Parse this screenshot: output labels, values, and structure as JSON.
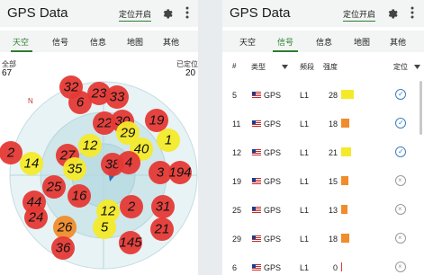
{
  "left_panel": {
    "app_title": "GPS Data",
    "locate_label": "定位开启",
    "tabs": [
      "天空",
      "信号",
      "信息",
      "地图",
      "其他"
    ],
    "active_tab": 0,
    "total_label": "全部",
    "total_value": "67",
    "fixed_label": "已定位",
    "fixed_value": "20",
    "compass_north": "N",
    "satellites": [
      {
        "id": "32",
        "color": "#e53935"
      },
      {
        "id": "6",
        "color": "#e53935"
      },
      {
        "id": "23",
        "color": "#e53935"
      },
      {
        "id": "33",
        "color": "#e53935"
      },
      {
        "id": "22",
        "color": "#e53935"
      },
      {
        "id": "30",
        "color": "#e53935"
      },
      {
        "id": "19",
        "color": "#e53935"
      },
      {
        "id": "29",
        "color": "#f4ea2a"
      },
      {
        "id": "1",
        "color": "#f4ea2a"
      },
      {
        "id": "2",
        "color": "#e53935"
      },
      {
        "id": "12",
        "color": "#f4ea2a"
      },
      {
        "id": "40",
        "color": "#f4ea2a"
      },
      {
        "id": "14",
        "color": "#f4ea2a"
      },
      {
        "id": "27",
        "color": "#e53935"
      },
      {
        "id": "35",
        "color": "#f4ea2a"
      },
      {
        "id": "38",
        "color": "#e53935"
      },
      {
        "id": "4",
        "color": "#e53935"
      },
      {
        "id": "3",
        "color": "#e53935"
      },
      {
        "id": "194",
        "color": "#e53935"
      },
      {
        "id": "25",
        "color": "#e53935"
      },
      {
        "id": "16",
        "color": "#e53935"
      },
      {
        "id": "44",
        "color": "#e53935"
      },
      {
        "id": "24",
        "color": "#e53935"
      },
      {
        "id": "12",
        "color": "#f4ea2a"
      },
      {
        "id": "2",
        "color": "#e53935"
      },
      {
        "id": "31",
        "color": "#e53935"
      },
      {
        "id": "26",
        "color": "#f08c2b"
      },
      {
        "id": "5",
        "color": "#f4ea2a"
      },
      {
        "id": "21",
        "color": "#e53935"
      },
      {
        "id": "36",
        "color": "#e53935"
      },
      {
        "id": "145",
        "color": "#e53935"
      }
    ]
  },
  "right_panel": {
    "app_title": "GPS Data",
    "locate_label": "定位开启",
    "tabs": [
      "天空",
      "信号",
      "信息",
      "地图",
      "其他"
    ],
    "active_tab": 1,
    "columns": [
      "#",
      "类型",
      "频段",
      "强度",
      "定位"
    ],
    "rows": [
      {
        "num": "5",
        "type": "GPS",
        "band": "L1",
        "strength": 28,
        "bar_color": "#f4ea2a",
        "used": true
      },
      {
        "num": "11",
        "type": "GPS",
        "band": "L1",
        "strength": 18,
        "bar_color": "#f08c2b",
        "used": true
      },
      {
        "num": "12",
        "type": "GPS",
        "band": "L1",
        "strength": 21,
        "bar_color": "#f4ea2a",
        "used": true
      },
      {
        "num": "19",
        "type": "GPS",
        "band": "L1",
        "strength": 15,
        "bar_color": "#f08c2b",
        "used": false
      },
      {
        "num": "25",
        "type": "GPS",
        "band": "L1",
        "strength": 13,
        "bar_color": "#f08c2b",
        "used": false
      },
      {
        "num": "29",
        "type": "GPS",
        "band": "L1",
        "strength": 18,
        "bar_color": "#f08c2b",
        "used": false
      },
      {
        "num": "6",
        "type": "GPS",
        "band": "L1",
        "strength": 0,
        "bar_color": "#e53935",
        "used": false
      }
    ]
  },
  "colors": {
    "accent": "#2e7d32",
    "strong": "#f4ea2a",
    "medium": "#f08c2b",
    "weak": "#e53935"
  }
}
